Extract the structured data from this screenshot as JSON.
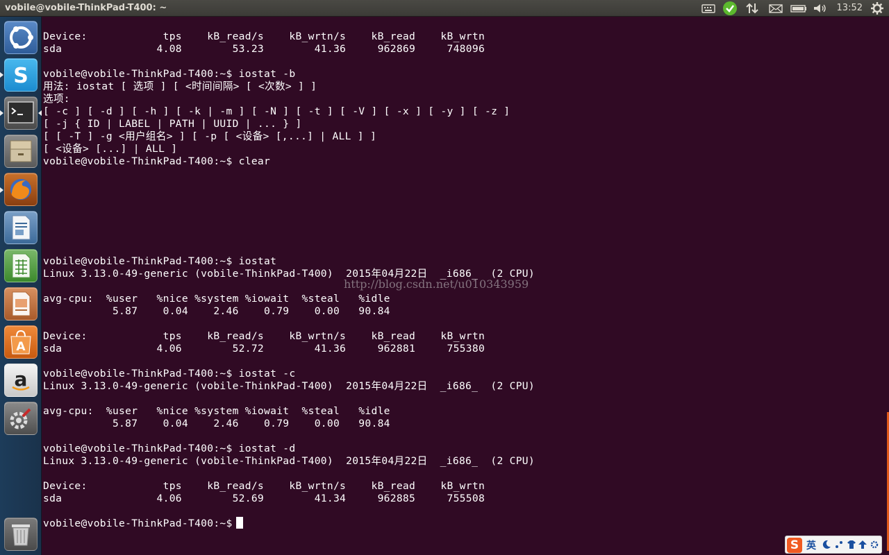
{
  "window": {
    "title": "vobile@vobile-ThinkPad-T400: ~"
  },
  "panel": {
    "clock": "13:52"
  },
  "launcher": {
    "items": [
      {
        "name": "dash-home"
      },
      {
        "name": "skype"
      },
      {
        "name": "terminal"
      },
      {
        "name": "files"
      },
      {
        "name": "firefox"
      },
      {
        "name": "libreoffice-writer"
      },
      {
        "name": "libreoffice-calc"
      },
      {
        "name": "libreoffice-impress"
      },
      {
        "name": "ubuntu-software-center"
      },
      {
        "name": "amazon"
      },
      {
        "name": "system-settings"
      },
      {
        "name": "trash"
      }
    ]
  },
  "terminal": {
    "lines": [
      "Device:            tps    kB_read/s    kB_wrtn/s    kB_read    kB_wrtn",
      "sda               4.08        53.23        41.36     962869     748096",
      "",
      "vobile@vobile-ThinkPad-T400:~$ iostat -b",
      "用法: iostat [ 选项 ] [ <时间间隔> [ <次数> ] ]",
      "选项:",
      "[ -c ] [ -d ] [ -h ] [ -k | -m ] [ -N ] [ -t ] [ -V ] [ -x ] [ -y ] [ -z ]",
      "[ -j { ID | LABEL | PATH | UUID | ... } ]",
      "[ [ -T ] -g <用户组名> ] [ -p [ <设备> [,...] | ALL ] ]",
      "[ <设备> [...] | ALL ]",
      "vobile@vobile-ThinkPad-T400:~$ clear",
      "",
      "",
      "",
      "",
      "",
      "",
      "",
      "vobile@vobile-ThinkPad-T400:~$ iostat",
      "Linux 3.13.0-49-generic (vobile-ThinkPad-T400)  2015年04月22日  _i686_  (2 CPU)",
      "",
      "avg-cpu:  %user   %nice %system %iowait  %steal   %idle",
      "           5.87    0.04    2.46    0.79    0.00   90.84",
      "",
      "Device:            tps    kB_read/s    kB_wrtn/s    kB_read    kB_wrtn",
      "sda               4.06        52.72        41.36     962881     755380",
      "",
      "vobile@vobile-ThinkPad-T400:~$ iostat -c",
      "Linux 3.13.0-49-generic (vobile-ThinkPad-T400)  2015年04月22日  _i686_  (2 CPU)",
      "",
      "avg-cpu:  %user   %nice %system %iowait  %steal   %idle",
      "           5.87    0.04    2.46    0.79    0.00   90.84",
      "",
      "vobile@vobile-ThinkPad-T400:~$ iostat -d",
      "Linux 3.13.0-49-generic (vobile-ThinkPad-T400)  2015年04月22日  _i686_  (2 CPU)",
      "",
      "Device:            tps    kB_read/s    kB_wrtn/s    kB_read    kB_wrtn",
      "sda               4.06        52.69        41.34     962885     755508",
      "",
      "vobile@vobile-ThinkPad-T400:~$ "
    ],
    "watermark": "http://blog.csdn.net/u010343959"
  },
  "ime": {
    "logo": "S",
    "lang": "英"
  },
  "colors": {
    "terminal_bg": "#300a24",
    "terminal_fg": "#ffffff",
    "panel_bg": "#3c3b37",
    "launcher_bg": "#1d3c5a"
  }
}
